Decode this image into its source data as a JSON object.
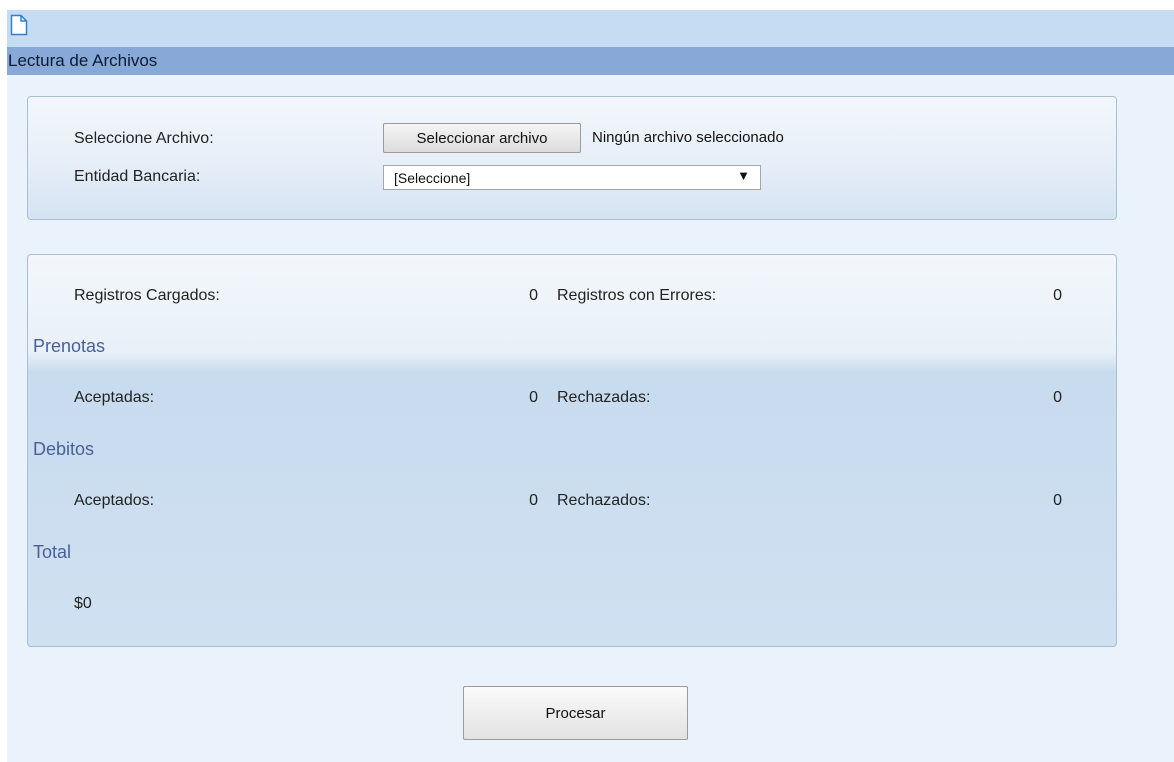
{
  "header": {
    "icon": "document-icon",
    "title": "Lectura de Archivos"
  },
  "form": {
    "file_label": "Seleccione Archivo:",
    "file_button": "Seleccionar archivo",
    "file_status": "Ningún archivo seleccionado",
    "bank_label": "Entidad Bancaria:",
    "bank_selected": "[Seleccione]",
    "bank_arrow": "▼"
  },
  "stats": {
    "loaded_label": "Registros Cargados:",
    "loaded_value": "0",
    "errors_label": "Registros con Errores:",
    "errors_value": "0",
    "prenotas": {
      "title": "Prenotas",
      "accepted_label": "Aceptadas:",
      "accepted_value": "0",
      "rejected_label": "Rechazadas:",
      "rejected_value": "0"
    },
    "debitos": {
      "title": "Debitos",
      "accepted_label": "Aceptados:",
      "accepted_value": "0",
      "rejected_label": "Rechazados:",
      "rejected_value": "0"
    },
    "total": {
      "title": "Total",
      "value": "$0"
    }
  },
  "actions": {
    "process_button": "Procesar"
  },
  "colors": {
    "header_bar": "#c6dcf3",
    "title_bar": "#88a9d8",
    "background": "#eaf2fb",
    "section_title": "#4a5f9a"
  }
}
